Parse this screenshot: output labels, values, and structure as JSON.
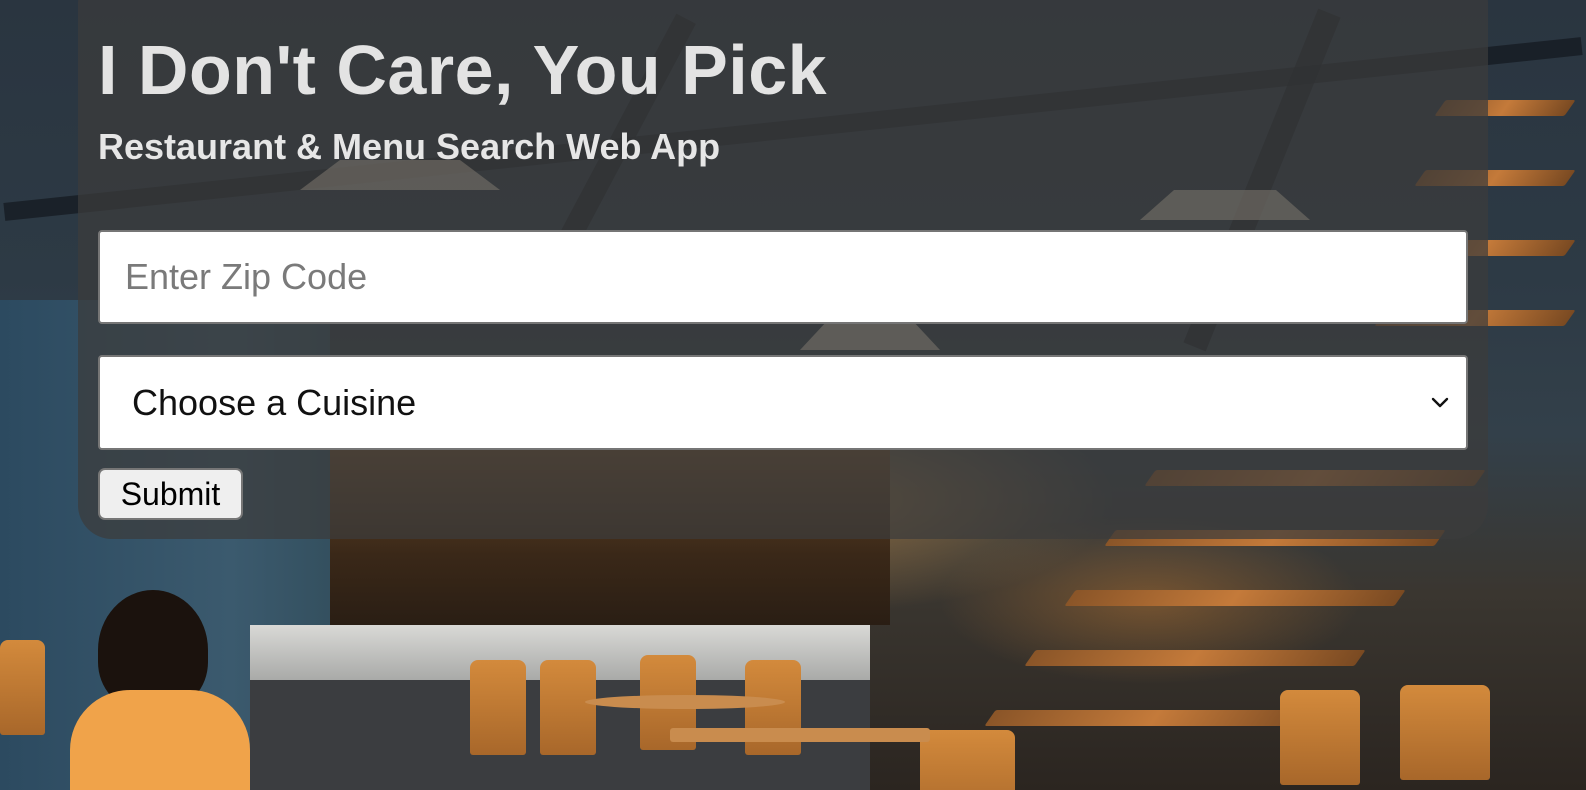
{
  "header": {
    "title": "I Don't Care, You Pick",
    "subtitle": "Restaurant & Menu Search Web App"
  },
  "form": {
    "zip": {
      "placeholder": "Enter Zip Code",
      "value": ""
    },
    "cuisine": {
      "selected": "Choose a Cuisine",
      "icon": "chevron-down-icon"
    },
    "submit_label": "Submit"
  },
  "colors": {
    "panel_overlay": "#3c3c3c",
    "title_text": "#e3e3e3",
    "input_border": "#767676",
    "button_bg": "#efefef"
  },
  "background": {
    "image": "restaurant-interior-photo"
  }
}
